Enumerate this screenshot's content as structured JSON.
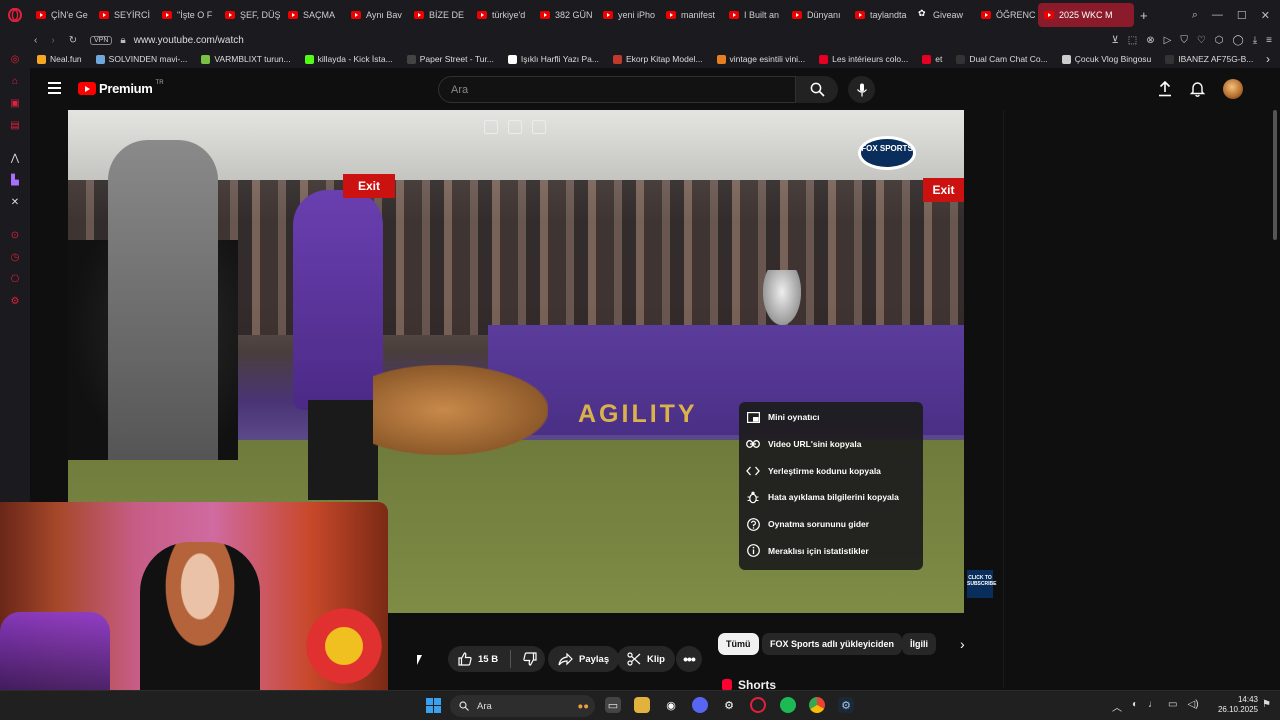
{
  "browser": {
    "tabs": [
      {
        "label": "ÇİN'e Ge",
        "icon": "youtube-icon"
      },
      {
        "label": "SEYİRCİ",
        "icon": "youtube-icon"
      },
      {
        "label": "\"İşte O F",
        "icon": "youtube-icon"
      },
      {
        "label": "ŞEF, DÜŞ",
        "icon": "youtube-icon"
      },
      {
        "label": "SAÇMA",
        "icon": "youtube-icon"
      },
      {
        "label": "Aynı Bav",
        "icon": "youtube-icon"
      },
      {
        "label": "BİZE DE",
        "icon": "youtube-icon"
      },
      {
        "label": "türkiye'd",
        "icon": "youtube-icon"
      },
      {
        "label": "382 GÜN",
        "icon": "youtube-icon"
      },
      {
        "label": "yeni iPho",
        "icon": "youtube-icon"
      },
      {
        "label": "manifest",
        "icon": "youtube-icon"
      },
      {
        "label": "I Built an",
        "icon": "youtube-icon"
      },
      {
        "label": "Dünyanı",
        "icon": "youtube-icon"
      },
      {
        "label": "taylandta",
        "icon": "youtube-icon"
      },
      {
        "label": "Giveaw",
        "icon": "gift-icon"
      },
      {
        "label": "ÖĞRENC",
        "icon": "youtube-icon"
      },
      {
        "label": "2025 WKC M",
        "icon": "youtube-icon",
        "active": true
      }
    ],
    "url": "www.youtube.com/watch",
    "vpn_label": "VPN",
    "bookmarks": [
      "Neal.fun",
      "SOLVINDEN mavi-...",
      "VARMBLIXT turun...",
      "killayda - Kick İsta...",
      "Paper Street - Tur...",
      "Işıklı Harfli Yazı Pa...",
      "Ekorp Kitap Model...",
      "vintage esintili vini...",
      "Les intérieurs colo...",
      "et",
      "Dual Cam Chat Co...",
      "Çocuk Vlog Bingosu",
      "IBANEZ AF75G-B..."
    ]
  },
  "youtube": {
    "brand": "Premium",
    "brand_sup": "TR",
    "search_placeholder": "Ara"
  },
  "video": {
    "overlay_texts": [
      "Exit",
      "Exit",
      "AGILITY"
    ],
    "channel_bug": "FOX SPORTS",
    "subscribe_badge": "CLICK TO SUBSCRIBE"
  },
  "context_menu": [
    {
      "label": "Mini oynatıcı",
      "icon": "miniplayer-icon"
    },
    {
      "label": "Video URL'sini kopyala",
      "icon": "link-icon"
    },
    {
      "label": "Yerleştirme kodunu kopyala",
      "icon": "embed-code-icon"
    },
    {
      "label": "Hata ayıklama bilgilerini kopyala",
      "icon": "debug-icon"
    },
    {
      "label": "Oynatma sorununu gider",
      "icon": "help-icon"
    },
    {
      "label": "Meraklısı için istatistikler",
      "icon": "info-icon"
    }
  ],
  "actions": {
    "likes": "15 B",
    "share": "Paylaş",
    "clip": "Klip"
  },
  "chips": [
    "Tümü",
    "FOX Sports adlı yükleyiciden",
    "İlgili"
  ],
  "shorts_label": "Shorts",
  "taskbar": {
    "search": "Ara",
    "time": "14:43",
    "date": "26.10.2025"
  },
  "colors": {
    "accent": "#ff0000",
    "active_tab": "#8b1a2a",
    "bg": "#0f0f0f"
  }
}
